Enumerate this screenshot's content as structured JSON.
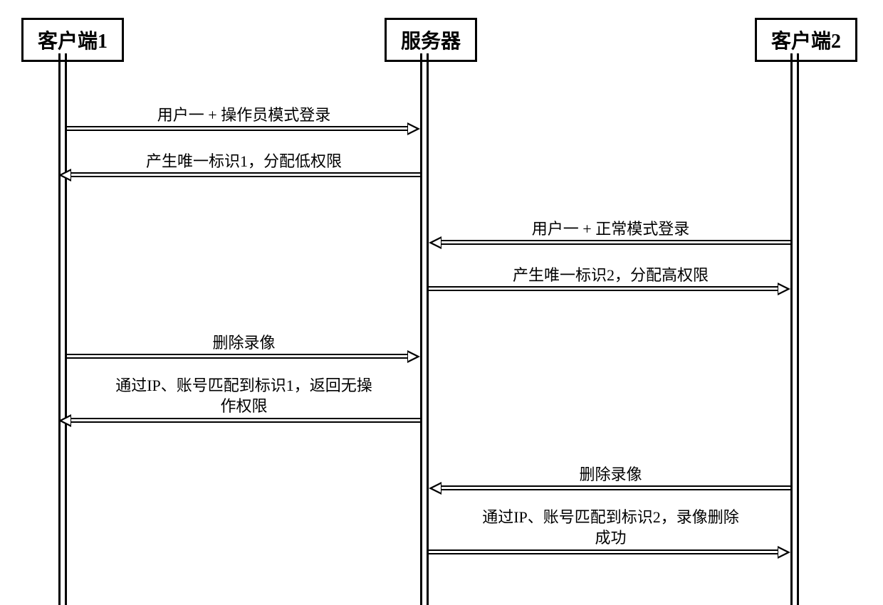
{
  "actors": {
    "client1": "客户端1",
    "server": "服务器",
    "client2": "客户端2"
  },
  "messages": {
    "m1": "用户一 + 操作员模式登录",
    "m2": "产生唯一标识1，分配低权限",
    "m3": "用户一 + 正常模式登录",
    "m4": "产生唯一标识2，分配高权限",
    "m5": "删除录像",
    "m6": "通过IP、账号匹配到标识1，返回无操\n作权限",
    "m7": "删除录像",
    "m8": "通过IP、账号匹配到标识2，录像删除\n成功"
  },
  "chart_data": {
    "type": "sequence-diagram",
    "actors": [
      "客户端1",
      "服务器",
      "客户端2"
    ],
    "messages": [
      {
        "from": "客户端1",
        "to": "服务器",
        "label": "用户一 + 操作员模式登录",
        "style": "double"
      },
      {
        "from": "服务器",
        "to": "客户端1",
        "label": "产生唯一标识1，分配低权限",
        "style": "double"
      },
      {
        "from": "客户端2",
        "to": "服务器",
        "label": "用户一 + 正常模式登录",
        "style": "double"
      },
      {
        "from": "服务器",
        "to": "客户端2",
        "label": "产生唯一标识2，分配高权限",
        "style": "double"
      },
      {
        "from": "客户端1",
        "to": "服务器",
        "label": "删除录像",
        "style": "double"
      },
      {
        "from": "服务器",
        "to": "客户端1",
        "label": "通过IP、账号匹配到标识1，返回无操作权限",
        "style": "double"
      },
      {
        "from": "客户端2",
        "to": "服务器",
        "label": "删除录像",
        "style": "double"
      },
      {
        "from": "服务器",
        "to": "客户端2",
        "label": "通过IP、账号匹配到标识2，录像删除成功",
        "style": "double"
      }
    ]
  }
}
